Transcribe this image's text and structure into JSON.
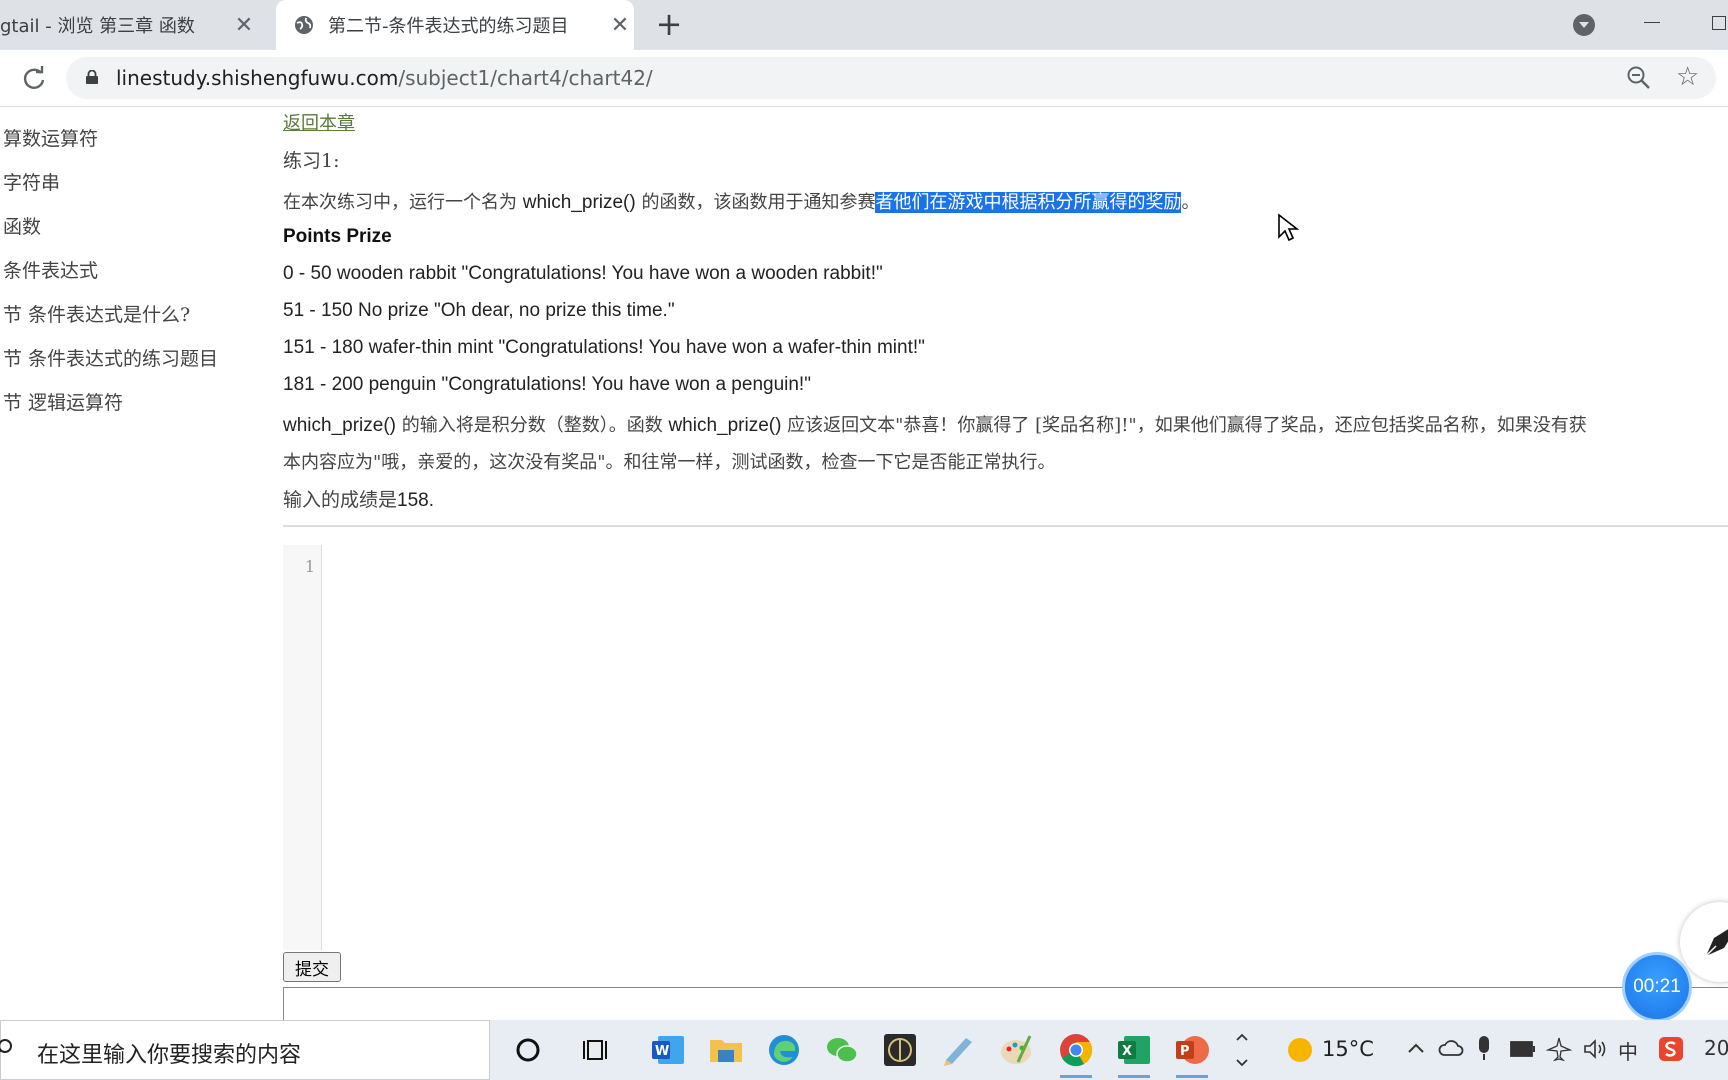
{
  "browser": {
    "tabs": [
      {
        "title": "gtail - 浏览 第三章 函数",
        "close": "✕"
      },
      {
        "title": "第二节-条件表达式的练习题目",
        "close": "✕"
      }
    ],
    "new_tab": "+",
    "url_host": "linestudy.shishengfuwu.com",
    "url_path": "/subject1/chart4/chart42/"
  },
  "sidebar": {
    "items": [
      {
        "label": "算数运算符"
      },
      {
        "label": "字符串"
      },
      {
        "label": "函数"
      },
      {
        "label": "条件表达式"
      },
      {
        "label": "节 条件表达式是什么?"
      },
      {
        "label": "节 条件表达式的练习题目"
      },
      {
        "label": "节 逻辑运算符"
      }
    ]
  },
  "main": {
    "back_link": "返回本章",
    "exercise_label": "练习1:",
    "intro_pre": "在本次练习中，运行一个名为 ",
    "func_name": "which_prize()",
    "intro_mid": " 的函数，该函数用于通知参赛",
    "intro_highlight": "者他们在游戏中根据积分所赢得的奖励",
    "intro_post": "。",
    "table_header": "Points Prize",
    "prize_rows": [
      "0 - 50 wooden rabbit \"Congratulations! You have won a wooden rabbit!\"",
      "51 - 150 No prize \"Oh dear, no prize this time.\"",
      "151 - 180 wafer-thin mint \"Congratulations! You have won a wafer-thin mint!\"",
      "181 - 200 penguin \"Congratulations! You have won a penguin!\""
    ],
    "desc1_a": "which_prize()",
    "desc1_b": " 的输入将是积分数（整数）。函数 ",
    "desc1_c": "which_prize()",
    "desc1_d": " 应该返回文本\"恭喜！你赢得了 [奖品名称]!\"，如果他们赢得了奖品，还应包括奖品名称，如果没有获",
    "desc2": "本内容应为\"哦，亲爱的，这次没有奖品\"。和往常一样，测试函数，检查一下它是否能正常执行。",
    "input_pre": "输入的成绩是",
    "input_value": "158."
  },
  "editor": {
    "line_number": "1",
    "submit_label": "提交"
  },
  "timer": "00:21",
  "taskbar": {
    "search_placeholder": "在这里输入你要搜索的内容",
    "weather": "15°C",
    "ime": "中",
    "clock_partial": "20"
  }
}
